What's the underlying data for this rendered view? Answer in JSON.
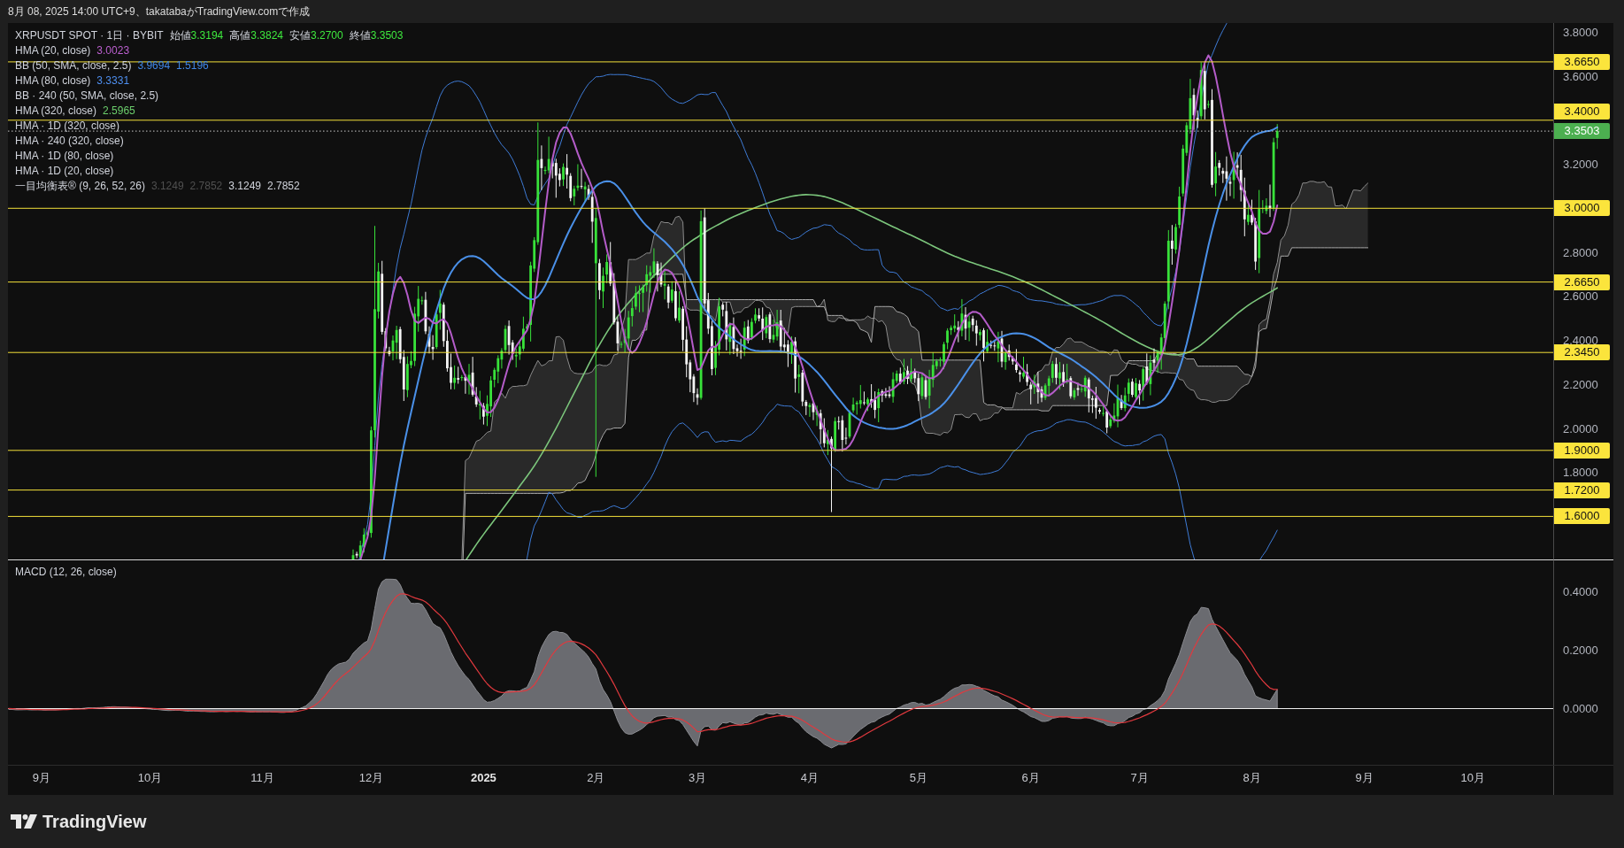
{
  "header": {
    "text": "8月 08, 2025 14:00 UTC+9、takatabaがTradingView.comで作成"
  },
  "price_pane": {
    "legend": {
      "symbol": "XRPUSDT SPOT · 1日 · BYBIT",
      "ohlc": [
        {
          "label": "始値",
          "value": "3.3194"
        },
        {
          "label": "高値",
          "value": "3.3824"
        },
        {
          "label": "安値",
          "value": "3.2700"
        },
        {
          "label": "終値",
          "value": "3.3503"
        }
      ]
    },
    "indicators": [
      {
        "name": "HMA (20, close)",
        "values": [
          {
            "text": "3.0023",
            "color": "#bb5fcf"
          }
        ]
      },
      {
        "name": "BB (50, SMA, close, 2.5)",
        "values": [
          {
            "text": "3.9694",
            "color": "#3f86e6"
          },
          {
            "text": "1.5196",
            "color": "#3f86e6"
          }
        ]
      },
      {
        "name": "HMA (80, close)",
        "values": [
          {
            "text": "3.3331",
            "color": "#4e8ff0"
          }
        ]
      },
      {
        "name": "BB · 240 (50, SMA, close, 2.5)"
      },
      {
        "name": "HMA (320, close)",
        "values": [
          {
            "text": "2.5965",
            "color": "#6ccf6c"
          }
        ]
      },
      {
        "name": "HMA · 1D (320, close)"
      },
      {
        "name": "HMA · 240 (320, close)"
      },
      {
        "name": "HMA · 1D (80, close)"
      },
      {
        "name": "HMA · 1D (20, close)"
      },
      {
        "name": "一目均衡表® (9, 26, 52, 26)",
        "values": [
          {
            "text": "3.1249",
            "color": "#505050"
          },
          {
            "text": "2.7852",
            "color": "#505050"
          },
          {
            "text": "3.1249",
            "color": "#d1d4dc"
          },
          {
            "text": "2.7852",
            "color": "#d1d4dc"
          }
        ]
      }
    ],
    "price_axis": {
      "ticks": [
        "3.8000",
        "3.6000",
        "3.2000",
        "2.8000",
        "2.6000",
        "2.4000",
        "2.2000",
        "2.0000",
        "1.8000"
      ]
    },
    "levels": [
      {
        "label": "3.6650"
      },
      {
        "label": "3.4000"
      },
      {
        "label": "3.0000"
      },
      {
        "label": "2.6650"
      },
      {
        "label": "2.3450"
      },
      {
        "label": "1.9000"
      },
      {
        "label": "1.7200"
      },
      {
        "label": "1.6000"
      }
    ],
    "last_price": {
      "label": "3.3503"
    }
  },
  "macd_pane": {
    "title": "MACD (12, 26, close)",
    "axis_ticks": [
      "0.4000",
      "0.2000",
      "0.0000"
    ]
  },
  "time_axis": [
    {
      "text": "9月",
      "kind": "month"
    },
    {
      "text": "10月",
      "kind": "month"
    },
    {
      "text": "11月",
      "kind": "month"
    },
    {
      "text": "12月",
      "kind": "month"
    },
    {
      "text": "2025",
      "kind": "year"
    },
    {
      "text": "2月",
      "kind": "month"
    },
    {
      "text": "3月",
      "kind": "month"
    },
    {
      "text": "4月",
      "kind": "month"
    },
    {
      "text": "5月",
      "kind": "month"
    },
    {
      "text": "6月",
      "kind": "month"
    },
    {
      "text": "7月",
      "kind": "month"
    },
    {
      "text": "8月",
      "kind": "month"
    },
    {
      "text": "9月",
      "kind": "month"
    },
    {
      "text": "10月",
      "kind": "month"
    }
  ],
  "footer": {
    "brand": "TradingView"
  }
}
